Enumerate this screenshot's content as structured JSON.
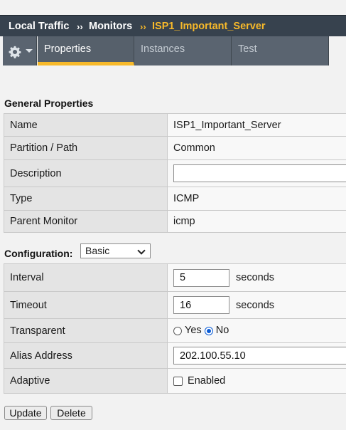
{
  "breadcrumb": {
    "part1": "Local Traffic",
    "sep1": "››",
    "part2": "Monitors",
    "sep2": "››",
    "current": "ISP1_Important_Server",
    "current_color": "#f7b92a"
  },
  "tabs": [
    {
      "label": "Properties",
      "active": true
    },
    {
      "label": "Instances",
      "active": false
    },
    {
      "label": "Test",
      "active": false
    }
  ],
  "general": {
    "title": "General Properties",
    "rows": {
      "name": {
        "label": "Name",
        "value": "ISP1_Important_Server"
      },
      "partition": {
        "label": "Partition / Path",
        "value": "Common"
      },
      "description": {
        "label": "Description",
        "value": ""
      },
      "type": {
        "label": "Type",
        "value": "ICMP"
      },
      "parent": {
        "label": "Parent Monitor",
        "value": "icmp"
      }
    }
  },
  "configuration": {
    "title": "Configuration:",
    "mode": "Basic",
    "interval": {
      "label": "Interval",
      "value": "5",
      "unit": "seconds"
    },
    "timeout": {
      "label": "Timeout",
      "value": "16",
      "unit": "seconds"
    },
    "transparent": {
      "label": "Transparent",
      "yes": "Yes",
      "no": "No",
      "selected": "No"
    },
    "alias": {
      "label": "Alias Address",
      "value": "202.100.55.10"
    },
    "adaptive": {
      "label": "Adaptive",
      "option": "Enabled",
      "checked": false
    }
  },
  "buttons": {
    "update": "Update",
    "delete": "Delete"
  },
  "icons": {
    "settings": "gear-icon",
    "settings_menu": "chevron-down-icon"
  }
}
